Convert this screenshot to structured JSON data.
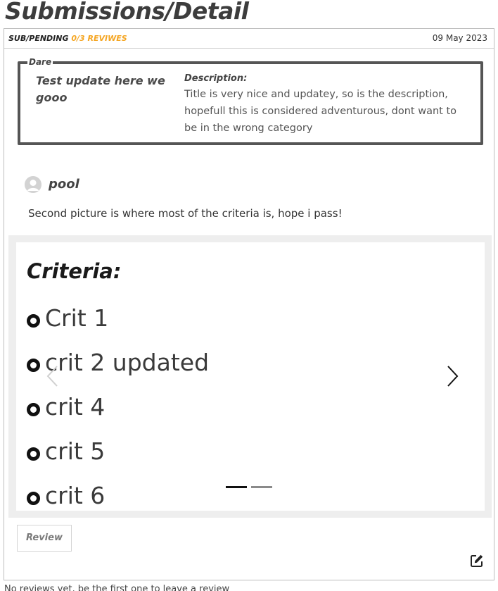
{
  "page": {
    "title": "Submissions/Detail"
  },
  "submission": {
    "status": "SUB/PENDING",
    "reviews": "0/3 REVIWES",
    "date": "09 May 2023",
    "review_button": "Review"
  },
  "dare": {
    "legend": "Dare",
    "title": "Test update here we gooo",
    "description_label": "Description:",
    "description": "Title is very nice and updatey, so is the description, hopefull this is considered adventurous, dont want to be in the wrong category"
  },
  "post": {
    "username": "pool",
    "comment": "Second picture is where most of the criteria is, hope i pass!"
  },
  "carousel": {
    "slide": {
      "heading": "Criteria:",
      "items": [
        "Crit 1",
        "crit 2 updated",
        "crit 4",
        "crit 5",
        "crit 6"
      ]
    },
    "indicators": [
      {
        "active": true,
        "color": "#111111"
      },
      {
        "active": false,
        "color": "#8a8a8a"
      }
    ]
  },
  "footer": {
    "text": "No reviews yet, be the first one to leave a review"
  },
  "colors": {
    "accent": "#f5a623",
    "box_border": "#555555"
  }
}
